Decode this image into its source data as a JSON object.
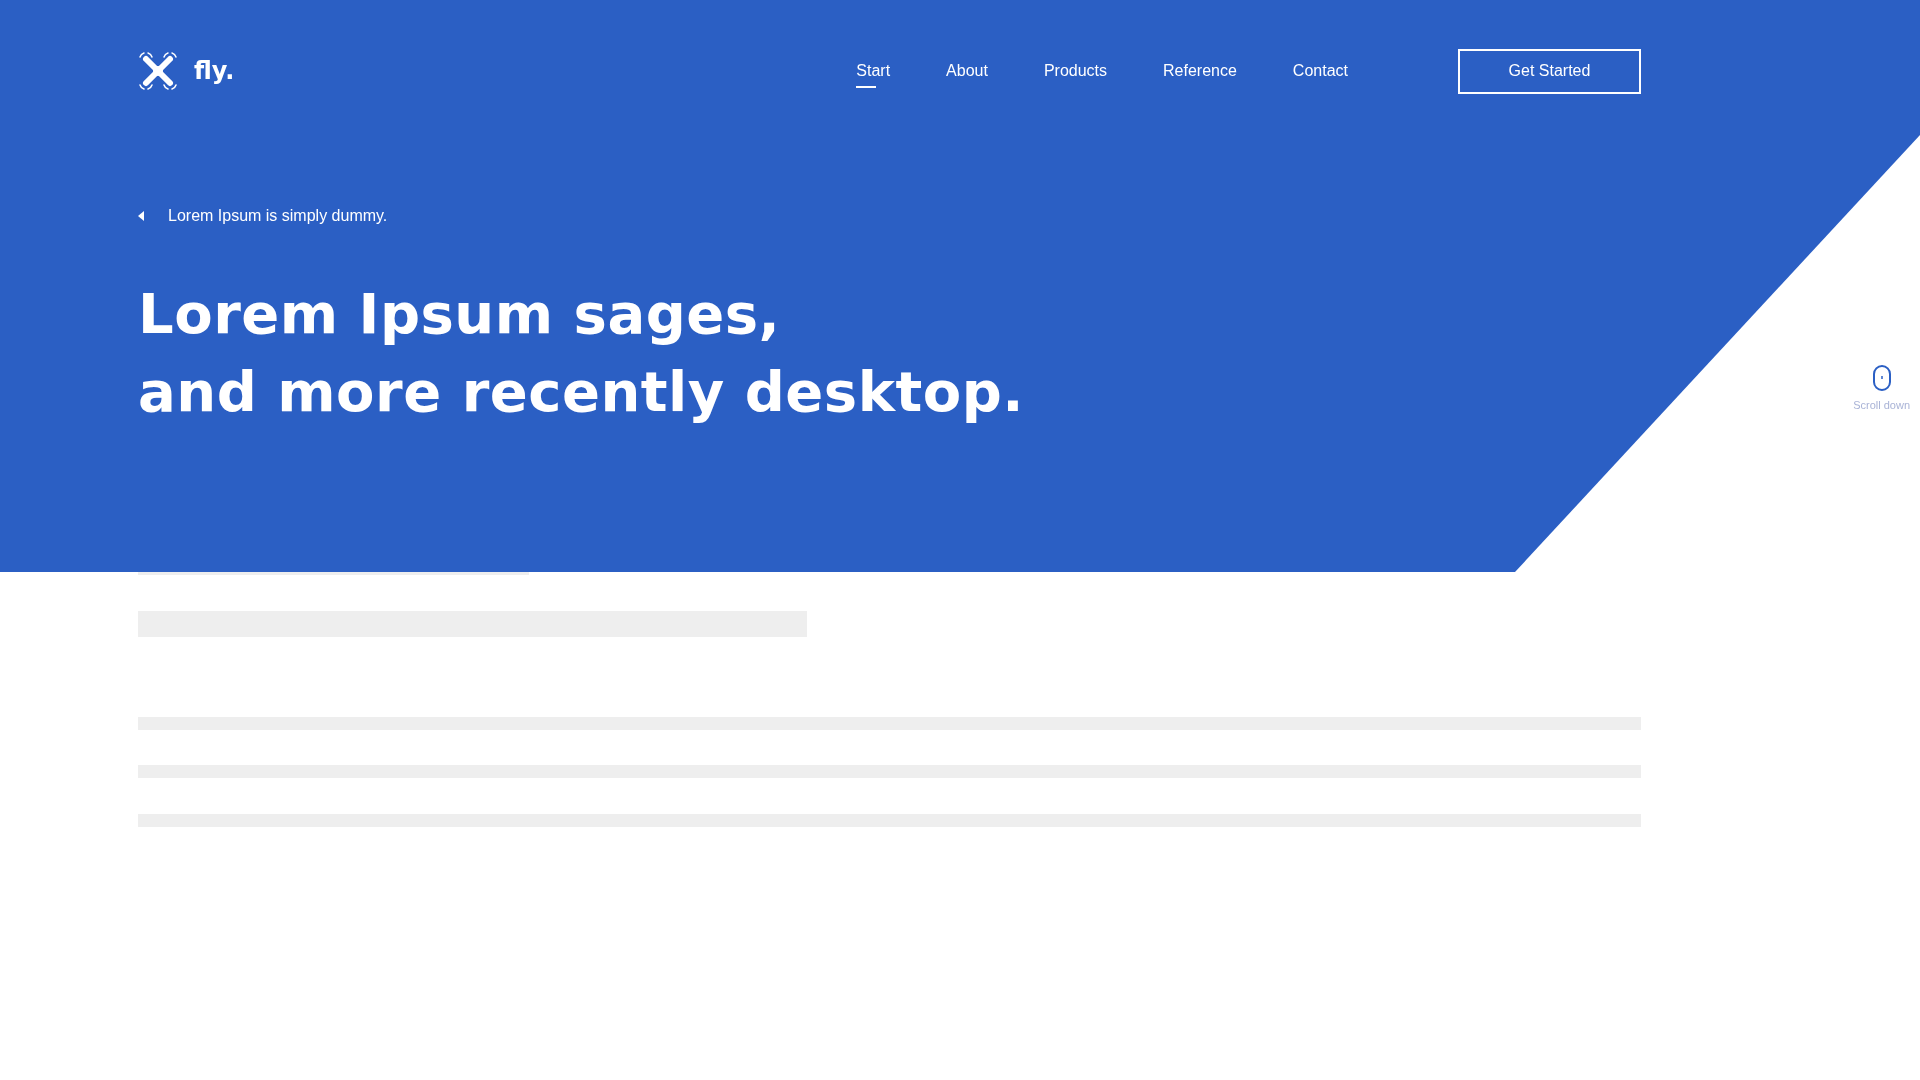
{
  "header": {
    "logo": {
      "text": "fly."
    },
    "nav": [
      {
        "label": "Start",
        "selected": true
      },
      {
        "label": "About",
        "selected": false
      },
      {
        "label": "Products",
        "selected": false
      },
      {
        "label": "Reference",
        "selected": false
      },
      {
        "label": "Contact",
        "selected": false
      }
    ],
    "cta": "Get Started"
  },
  "hero": {
    "eyebrow": "Lorem Ipsum is simply dummy.",
    "headline": [
      "Lorem Ipsum sages,",
      "and more recently desktop."
    ],
    "scroll_hint": "Scroll down"
  }
}
